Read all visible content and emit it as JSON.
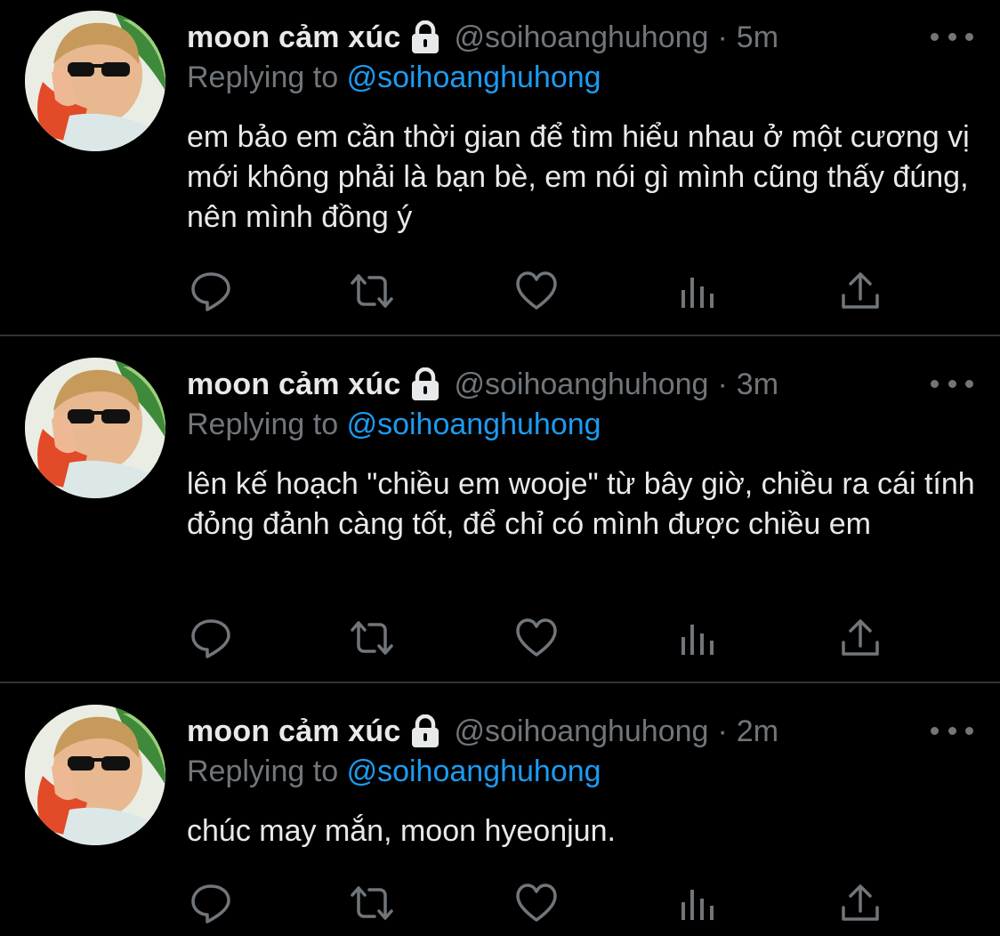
{
  "colors": {
    "background": "#000000",
    "text": "#e7e9ea",
    "secondary": "#71767b",
    "link": "#1d9bf0",
    "divider": "#2f3336"
  },
  "tweets": [
    {
      "name": "moon cảm xúc",
      "handle": "@soihoanghuhong",
      "dot": "·",
      "time": "5m",
      "reply_prefix": "Replying to",
      "reply_to": "@soihoanghuhong",
      "text": "em bảo em cần thời gian để tìm hiểu nhau ở một cương vị mới không phải là bạn bè, em nói gì mình cũng thấy đúng, nên mình đồng ý"
    },
    {
      "name": "moon cảm xúc",
      "handle": "@soihoanghuhong",
      "dot": "·",
      "time": "3m",
      "reply_prefix": "Replying to",
      "reply_to": "@soihoanghuhong",
      "text": "lên kế hoạch \"chiều em wooje\" từ bây giờ, chiều ra cái tính đỏng đảnh càng tốt, để chỉ có mình được chiều em"
    },
    {
      "name": "moon cảm xúc",
      "handle": "@soihoanghuhong",
      "dot": "·",
      "time": "2m",
      "reply_prefix": "Replying to",
      "reply_to": "@soihoanghuhong",
      "text": "chúc may mắn, moon hyeonjun."
    }
  ],
  "icons": [
    "reply-icon",
    "retweet-icon",
    "like-icon",
    "analytics-icon",
    "share-icon",
    "more-icon",
    "lock-icon"
  ]
}
